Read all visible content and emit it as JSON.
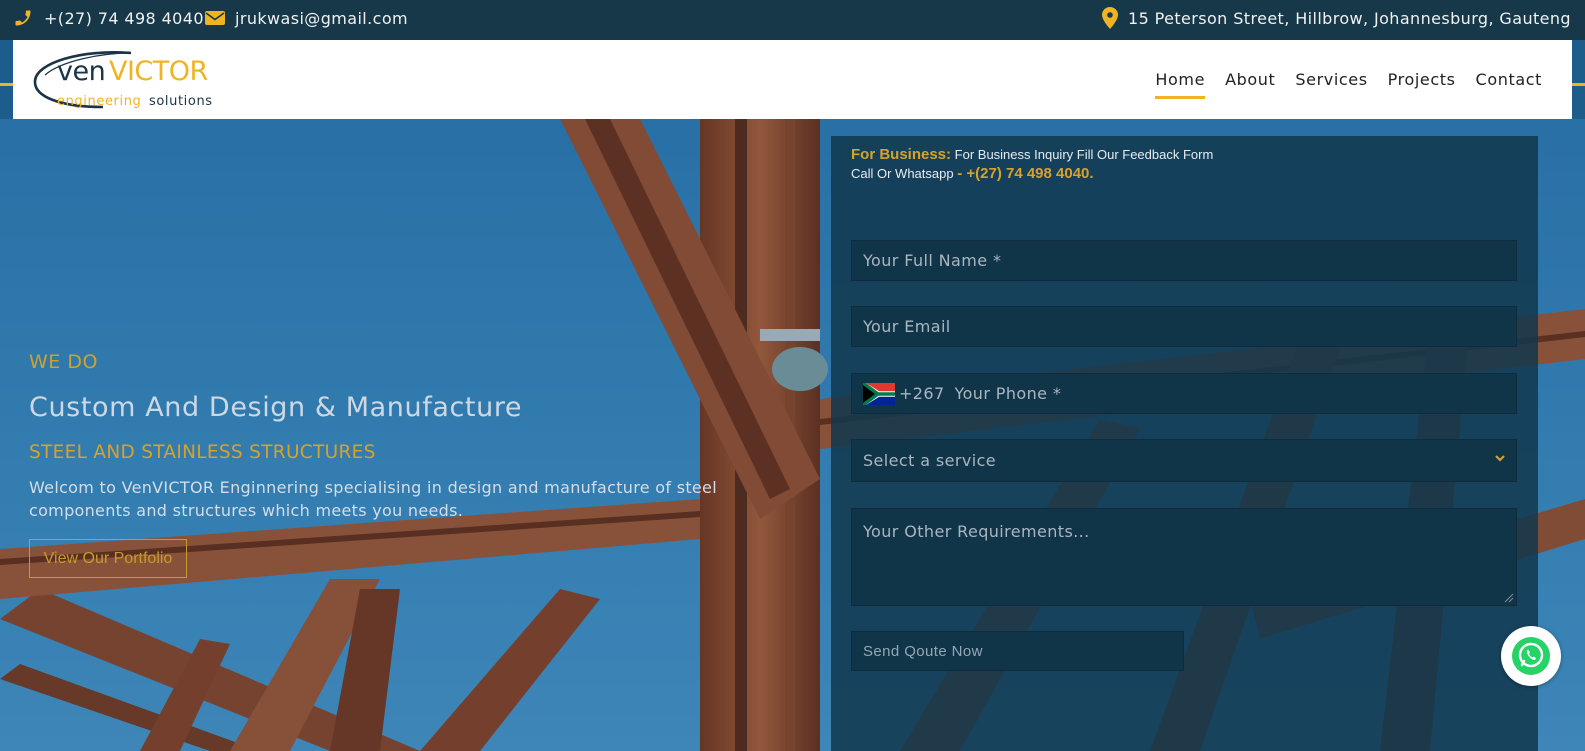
{
  "topbar": {
    "phone": "+(27) 74 498 4040",
    "email": "jrukwasi@gmail.com",
    "address": "15 Peterson Street, Hillbrow, Johannesburg, Gauteng",
    "icons": [
      "phone-icon",
      "envelope-icon",
      "map-marker-icon"
    ],
    "icon_color": "#f0b323"
  },
  "logo": {
    "ven": "ven",
    "victor": "VICTOR",
    "engineering": "engineering",
    "solutions": "solutions"
  },
  "nav": {
    "items": [
      "Home",
      "About",
      "Services",
      "Projects",
      "Contact"
    ],
    "active": "Home"
  },
  "hero": {
    "eyebrow": "WE DO",
    "headline": "Custom And Design & Manufacture",
    "subhead": "STEEL AND STAINLESS STRUCTURES",
    "description": "Welcom to VenVICTOR Enginnering specialising in design and manufacture of steel components and structures which meets you needs.",
    "cta": "View Our Portfolio"
  },
  "form": {
    "business_label": "For Business:",
    "business_text": "For Business Inquiry Fill Our Feedback Form",
    "call_text": "Call Or Whatsapp",
    "call_number": "- +(27) 74 498 4040.",
    "name_placeholder": "Your Full Name *",
    "email_placeholder": "Your Email",
    "dial_code": "+267",
    "phone_placeholder": "Your Phone *",
    "service_placeholder": "Select a service",
    "requirements_placeholder": "Your Other Requirements...",
    "submit": "Send Qoute Now"
  },
  "colors": {
    "accent": "#f0b323",
    "topbar": "#163849",
    "panel": "#12384e"
  }
}
